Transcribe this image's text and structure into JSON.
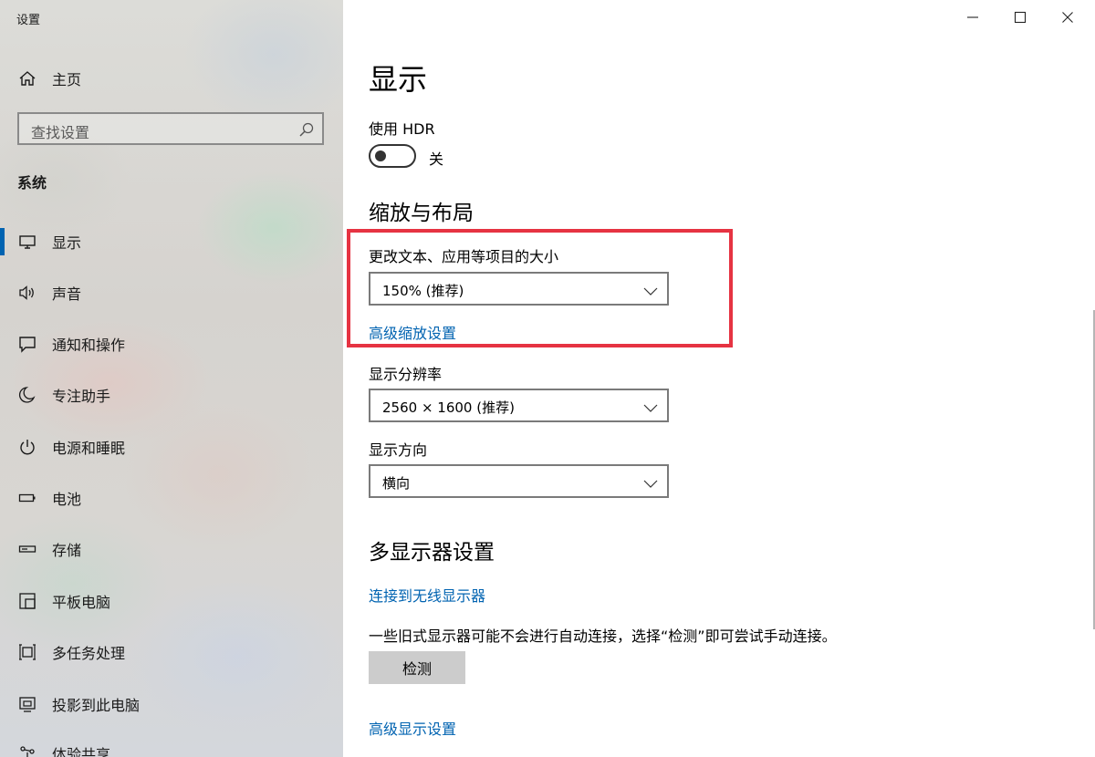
{
  "window": {
    "title": "设置",
    "caption_buttons": [
      "minimize",
      "maximize",
      "close"
    ]
  },
  "sidebar": {
    "home_label": "主页",
    "home_icon": "home-icon",
    "search_placeholder": "查找设置",
    "section_label": "系统",
    "items": [
      {
        "label": "显示",
        "icon": "monitor-icon",
        "selected": true
      },
      {
        "label": "声音",
        "icon": "speaker-icon",
        "selected": false
      },
      {
        "label": "通知和操作",
        "icon": "notification-icon",
        "selected": false
      },
      {
        "label": "专注助手",
        "icon": "moon-icon",
        "selected": false
      },
      {
        "label": "电源和睡眠",
        "icon": "power-icon",
        "selected": false
      },
      {
        "label": "电池",
        "icon": "battery-icon",
        "selected": false
      },
      {
        "label": "存储",
        "icon": "storage-icon",
        "selected": false
      },
      {
        "label": "平板电脑",
        "icon": "tablet-icon",
        "selected": false
      },
      {
        "label": "多任务处理",
        "icon": "multitasking-icon",
        "selected": false
      },
      {
        "label": "投影到此电脑",
        "icon": "projection-icon",
        "selected": false
      },
      {
        "label": "体验共享",
        "icon": "share-icon",
        "selected": false
      }
    ]
  },
  "main": {
    "title": "显示",
    "hdr": {
      "label": "使用 HDR",
      "state_label": "关",
      "on": false
    },
    "scale_section": {
      "heading": "缩放与布局",
      "scale_label": "更改文本、应用等项目的大小",
      "scale_value": "150% (推荐)",
      "advanced_link": "高级缩放设置",
      "resolution_label": "显示分辨率",
      "resolution_value": "2560 × 1600 (推荐)",
      "orientation_label": "显示方向",
      "orientation_value": "横向"
    },
    "multi_display": {
      "heading": "多显示器设置",
      "wireless_link": "连接到无线显示器",
      "note": "一些旧式显示器可能不会进行自动连接，选择“检测”即可尝试手动连接。",
      "detect_button": "检测",
      "advanced_link": "高级显示设置"
    }
  },
  "colors": {
    "accent": "#0063b1",
    "highlight_border": "#e63342"
  }
}
